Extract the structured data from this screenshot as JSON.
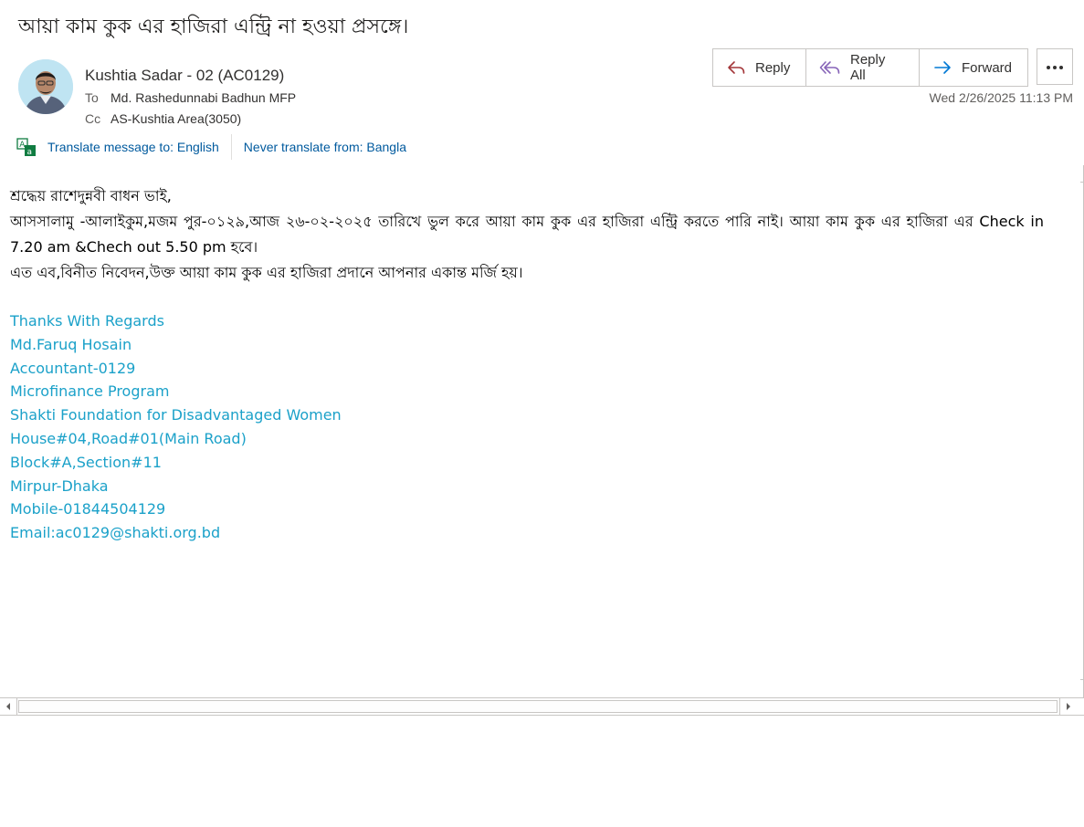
{
  "email": {
    "subject": "আয়া কাম কুক এর হাজিরা এন্ট্রি না হওয়া প্রসঙ্গে।",
    "sender": "Kushtia Sadar - 02 (AC0129)",
    "to_label": "To",
    "to": "Md. Rashedunnabi Badhun MFP",
    "cc_label": "Cc",
    "cc": "AS-Kushtia Area(3050)",
    "date": "Wed 2/26/2025 11:13 PM"
  },
  "actions": {
    "reply": "Reply",
    "reply_all": "Reply All",
    "forward": "Forward",
    "more": "..."
  },
  "translate": {
    "translate_to": "Translate message to: English",
    "never_translate": "Never translate from: Bangla"
  },
  "body": {
    "greeting": "শ্রদ্ধেয় রাশেদুন্নবী বাধন ভাই,",
    "para1": "আসসালামু -আলাইকুম,মজম পুর-০১২৯,আজ ২৬-০২-২০২৫ তারিখে ভুল করে আয়া কাম কুক এর হাজিরা এন্ট্রি করতে পারি নাই। আয়া কাম কুক এর হাজিরা এর Check in 7.20 am &Chech out 5.50 pm হবে।",
    "para2": "এত এব,বিনীত নিবেদন,উক্ত আয়া কাম কুক এর হাজিরা প্রদানে আপনার একান্ত মর্জি হয়।"
  },
  "signature": [
    "Thanks With Regards",
    "Md.Faruq Hosain",
    "Accountant-0129",
    "Microfinance Program",
    "Shakti Foundation for Disadvantaged Women",
    "House#04,Road#01(Main Road)",
    "Block#A,Section#11",
    "Mirpur-Dhaka",
    "Mobile-01844504129",
    "Email:ac0129@shakti.org.bd"
  ],
  "colors": {
    "accent_link": "#005a9e",
    "signature": "#1ba1c9",
    "reply_icon": "#a4373a",
    "reply_all_icon": "#8764b8",
    "forward_icon": "#0078d4"
  },
  "icons": {
    "reply": "reply-arrow-icon",
    "reply_all": "reply-all-arrow-icon",
    "forward": "forward-arrow-icon",
    "more": "more-horizontal-icon",
    "translate": "translate-icon"
  }
}
